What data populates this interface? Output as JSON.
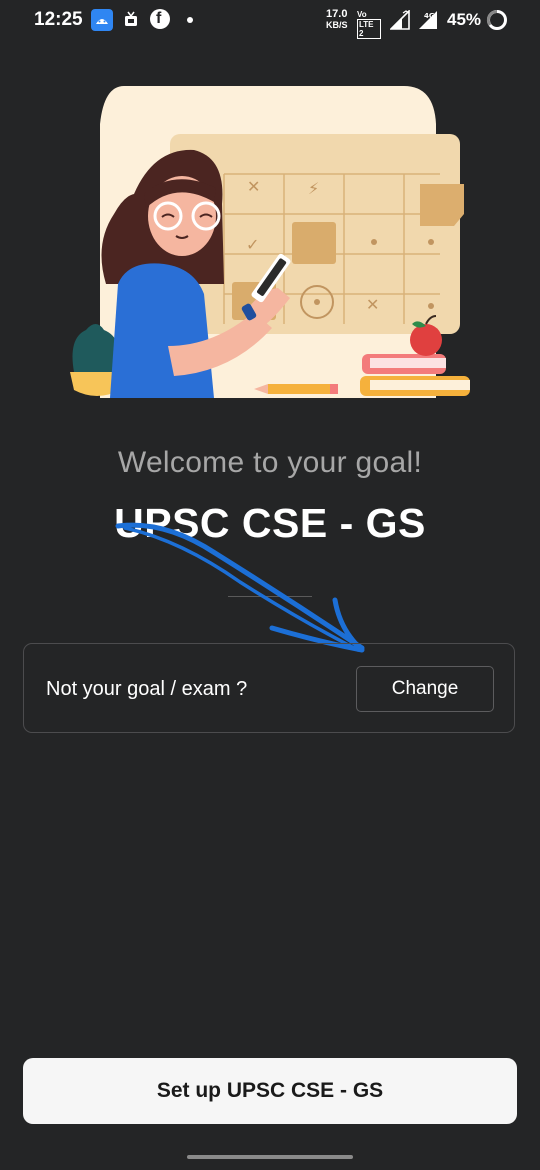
{
  "status_bar": {
    "time": "12:25",
    "network_speed_value": "17.0",
    "network_speed_unit": "KB/S",
    "volte_top": "Vo ",
    "volte_bottom": "LTE 2",
    "battery": "45%",
    "icons": [
      "android-app-icon",
      "tv-icon",
      "facebook-icon",
      "notification-dot-icon",
      "signal-icon",
      "signal-4g-icon",
      "battery-saver-ring-icon"
    ]
  },
  "main": {
    "welcome_text": "Welcome to your goal!",
    "goal_name": "UPSC CSE - GS"
  },
  "goal_card": {
    "prompt": "Not your goal / exam ?",
    "change_label": "Change"
  },
  "footer": {
    "setup_label": "Set up UPSC CSE - GS"
  },
  "colors": {
    "background": "#242526",
    "accent_arrow": "#1c6fd6",
    "button_bg": "#f6f6f6"
  }
}
